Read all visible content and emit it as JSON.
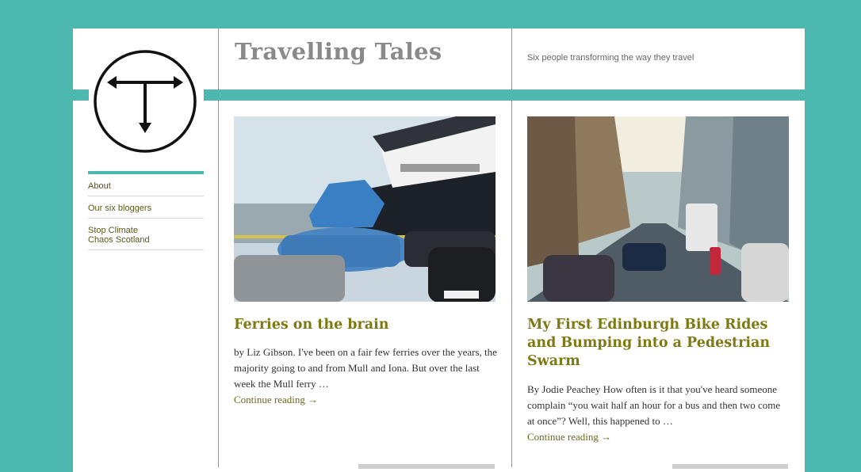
{
  "header": {
    "site_title": "Travelling Tales",
    "tagline": "Six people transforming the way they travel"
  },
  "sidebar": {
    "items": [
      {
        "label": "About"
      },
      {
        "label": "Our six bloggers"
      },
      {
        "label": "Stop Climate\nChaos Scotland"
      }
    ]
  },
  "posts": [
    {
      "title": "Ferries on the brain",
      "excerpt": "by Liz Gibson. I've been on a fair few ferries over the years, the majority going to and from Mull and Iona. But over the last week the Mull ferry …",
      "more": "Continue reading →"
    },
    {
      "title": "My First Edinburgh Bike Rides and Bumping into a Pedestrian Swarm",
      "excerpt": "By Jodie Peachey How often is it that you've heard someone complain “you wait half an hour for a bus and then two come at once”? Well, this happened to …",
      "more": "Continue reading →"
    }
  ],
  "colors": {
    "background": "#4db8b0",
    "title": "#7d7a14",
    "site_title": "#8a8a8a"
  }
}
